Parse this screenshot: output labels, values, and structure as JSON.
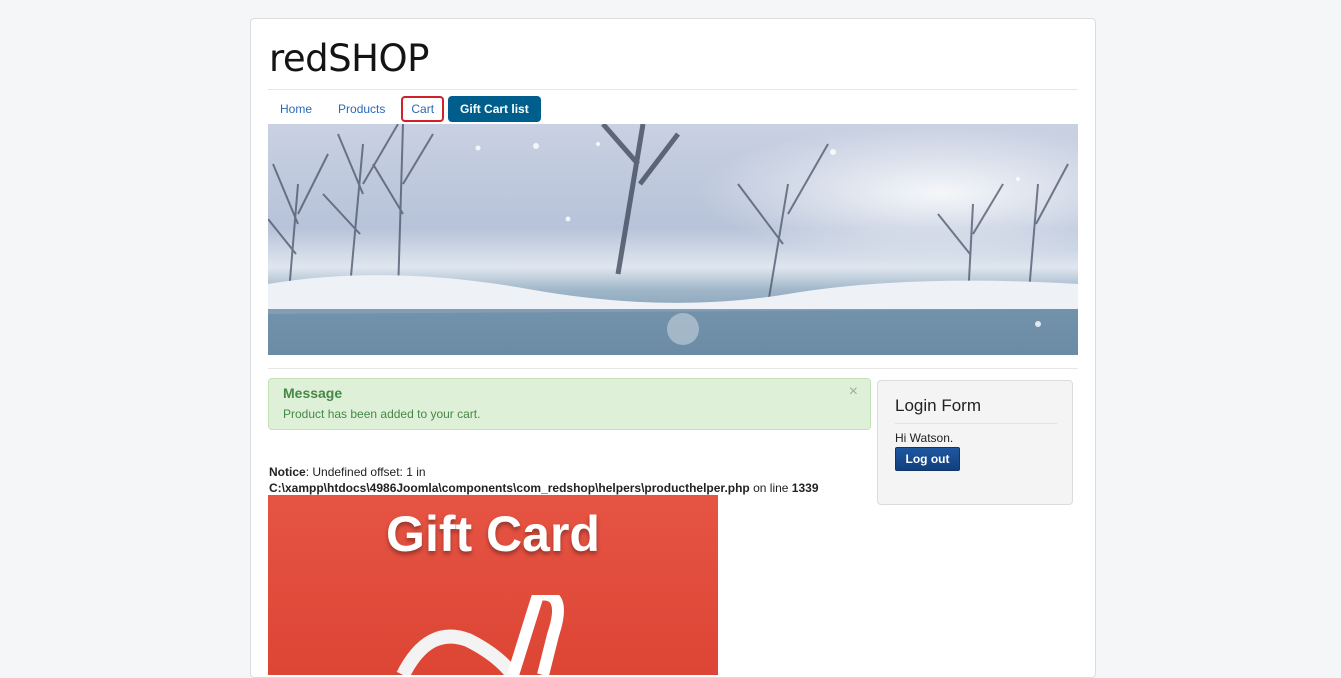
{
  "site": {
    "title": "redSHOP"
  },
  "nav": {
    "items": [
      {
        "label": "Home"
      },
      {
        "label": "Products"
      },
      {
        "label": "Cart"
      },
      {
        "label": "Gift Cart list"
      }
    ]
  },
  "message": {
    "heading": "Message",
    "text": "Product has been added to your cart.",
    "close": "×"
  },
  "notice": {
    "label": "Notice",
    "text1": ": Undefined offset: 1 in",
    "path": "C:\\xampp\\htdocs\\4986Joomla\\components\\com_redshop\\helpers\\producthelper.php",
    "text2": " on line ",
    "line": "1339"
  },
  "gift_card": {
    "title": "Gift Card"
  },
  "login": {
    "title": "Login Form",
    "greeting": "Hi Watson.",
    "logout_label": "Log out"
  },
  "colors": {
    "nav_active": "#005e8d",
    "cart_highlight": "#d0202a",
    "alert_bg": "#dff0d8",
    "alert_text": "#468847",
    "gift_card_bg": "#e04a3a",
    "logout_button": "#1b4f95"
  }
}
